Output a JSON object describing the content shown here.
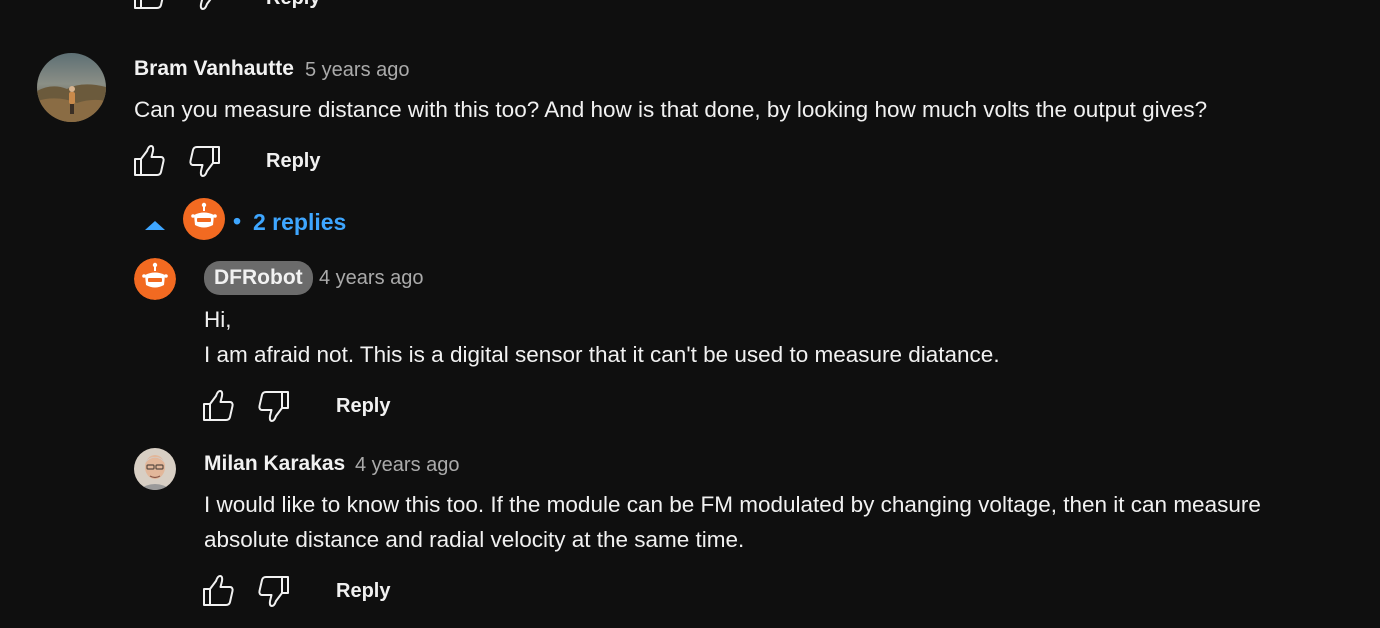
{
  "top_actions": {
    "reply_label": "Reply"
  },
  "comment": {
    "author": "Bram Vanhautte",
    "time": "5 years ago",
    "text": "Can you measure distance with this too? And how is that done, by looking how much volts the output gives?",
    "reply_label": "Reply"
  },
  "replies_toggle": {
    "bullet": "•",
    "label": "2 replies"
  },
  "replies": [
    {
      "author": "DFRobot",
      "time": "4 years ago",
      "lines": [
        "Hi,",
        "I am afraid not. This is a digital sensor that it can't be used to measure diatance."
      ],
      "reply_label": "Reply"
    },
    {
      "author": "Milan Karakas",
      "time": "4 years ago",
      "lines": [
        "I would like to know this too. If the module can be FM modulated by changing voltage, then it can measure",
        "absolute distance and radial velocity at the same time."
      ],
      "reply_label": "Reply"
    }
  ],
  "colors": {
    "background": "#0f0f0f",
    "text": "#f1f1f1",
    "secondary": "#aaaaaa",
    "link": "#3ea6ff",
    "brand_orange": "#f26a21"
  }
}
